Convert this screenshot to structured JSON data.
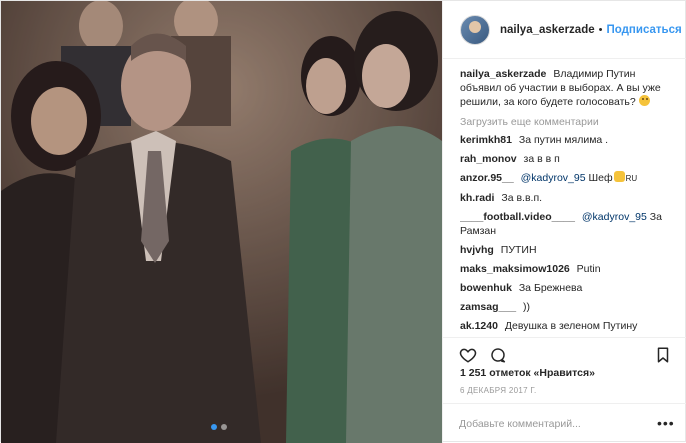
{
  "header": {
    "username": "nailya_askerzade",
    "separator": "•",
    "follow_label": "Подписаться"
  },
  "caption": {
    "username": "nailya_askerzade",
    "text": "Владимир Путин объявил об участии в выборах. А вы уже решили, за кого будете голосовать?"
  },
  "load_more_label": "Загрузить еще комментарии",
  "comments": [
    {
      "user": "kerimkh81",
      "text": "За путин мялима ."
    },
    {
      "user": "rah_monov",
      "text": "за в в п"
    },
    {
      "user": "anzor.95__",
      "mention": "@kadyrov_95",
      "text": "Шеф",
      "suffix": "RU"
    },
    {
      "user": "kh.radi",
      "text": "За в.в.п."
    },
    {
      "user": "____football.video____",
      "mention": "@kadyrov_95",
      "text": "За Рамзан"
    },
    {
      "user": "hvjvhg",
      "text": "ПУТИН"
    },
    {
      "user": "maks_maksimow1026",
      "text": "Putin"
    },
    {
      "user": "bowenhuk",
      "text": "За Брежнева"
    },
    {
      "user": "zamsag___",
      "text": "))"
    },
    {
      "user": "ak.1240",
      "text": "Девушка в зеленом Путину трицепс передовила"
    }
  ],
  "likes_label": "1 251 отметок «Нравится»",
  "date_label": "6 ДЕКАБРЯ 2017 Г.",
  "comment_input": {
    "placeholder": "Добавьте комментарий..."
  },
  "more_label": "•••",
  "icons": {
    "heart": "heart-icon",
    "comment": "comment-icon",
    "bookmark": "bookmark-icon",
    "more": "more-icon"
  },
  "colors": {
    "accent": "#3897f0",
    "mention": "#003569",
    "muted": "#999999",
    "text": "#262626"
  },
  "carousel": {
    "count": 2,
    "active": 0
  }
}
